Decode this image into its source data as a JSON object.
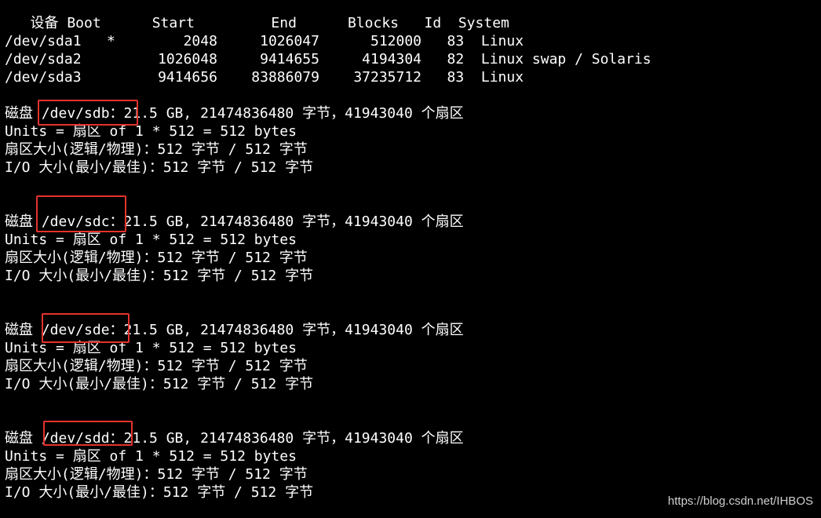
{
  "partition_table": {
    "header": "   设备 Boot      Start         End      Blocks   Id  System",
    "rows": [
      "/dev/sda1   *        2048     1026047      512000   83  Linux",
      "/dev/sda2         1026048     9414655     4194304   82  Linux swap / Solaris",
      "/dev/sda3         9414656    83886079    37235712   83  Linux"
    ]
  },
  "disks": [
    {
      "disk_line": "磁盘 /dev/sdb：21.5 GB, 21474836480 字节，41943040 个扇区",
      "units": "Units = 扇区 of 1 * 512 = 512 bytes",
      "sector_size": "扇区大小(逻辑/物理)：512 字节 / 512 字节",
      "io_size": "I/O 大小(最小/最佳)：512 字节 / 512 字节"
    },
    {
      "disk_line": "磁盘 /dev/sdc：21.5 GB, 21474836480 字节，41943040 个扇区",
      "units": "Units = 扇区 of 1 * 512 = 512 bytes",
      "sector_size": "扇区大小(逻辑/物理)：512 字节 / 512 字节",
      "io_size": "I/O 大小(最小/最佳)：512 字节 / 512 字节"
    },
    {
      "disk_line": "磁盘 /dev/sde：21.5 GB, 21474836480 字节，41943040 个扇区",
      "units": "Units = 扇区 of 1 * 512 = 512 bytes",
      "sector_size": "扇区大小(逻辑/物理)：512 字节 / 512 字节",
      "io_size": "I/O 大小(最小/最佳)：512 字节 / 512 字节"
    },
    {
      "disk_line": "磁盘 /dev/sdd：21.5 GB, 21474836480 字节，41943040 个扇区",
      "units": "Units = 扇区 of 1 * 512 = 512 bytes",
      "sector_size": "扇区大小(逻辑/物理)：512 字节 / 512 字节",
      "io_size": "I/O 大小(最小/最佳)：512 字节 / 512 字节"
    }
  ],
  "highlight_color": "#e5322d",
  "watermark": "https://blog.csdn.net/IHBOS"
}
